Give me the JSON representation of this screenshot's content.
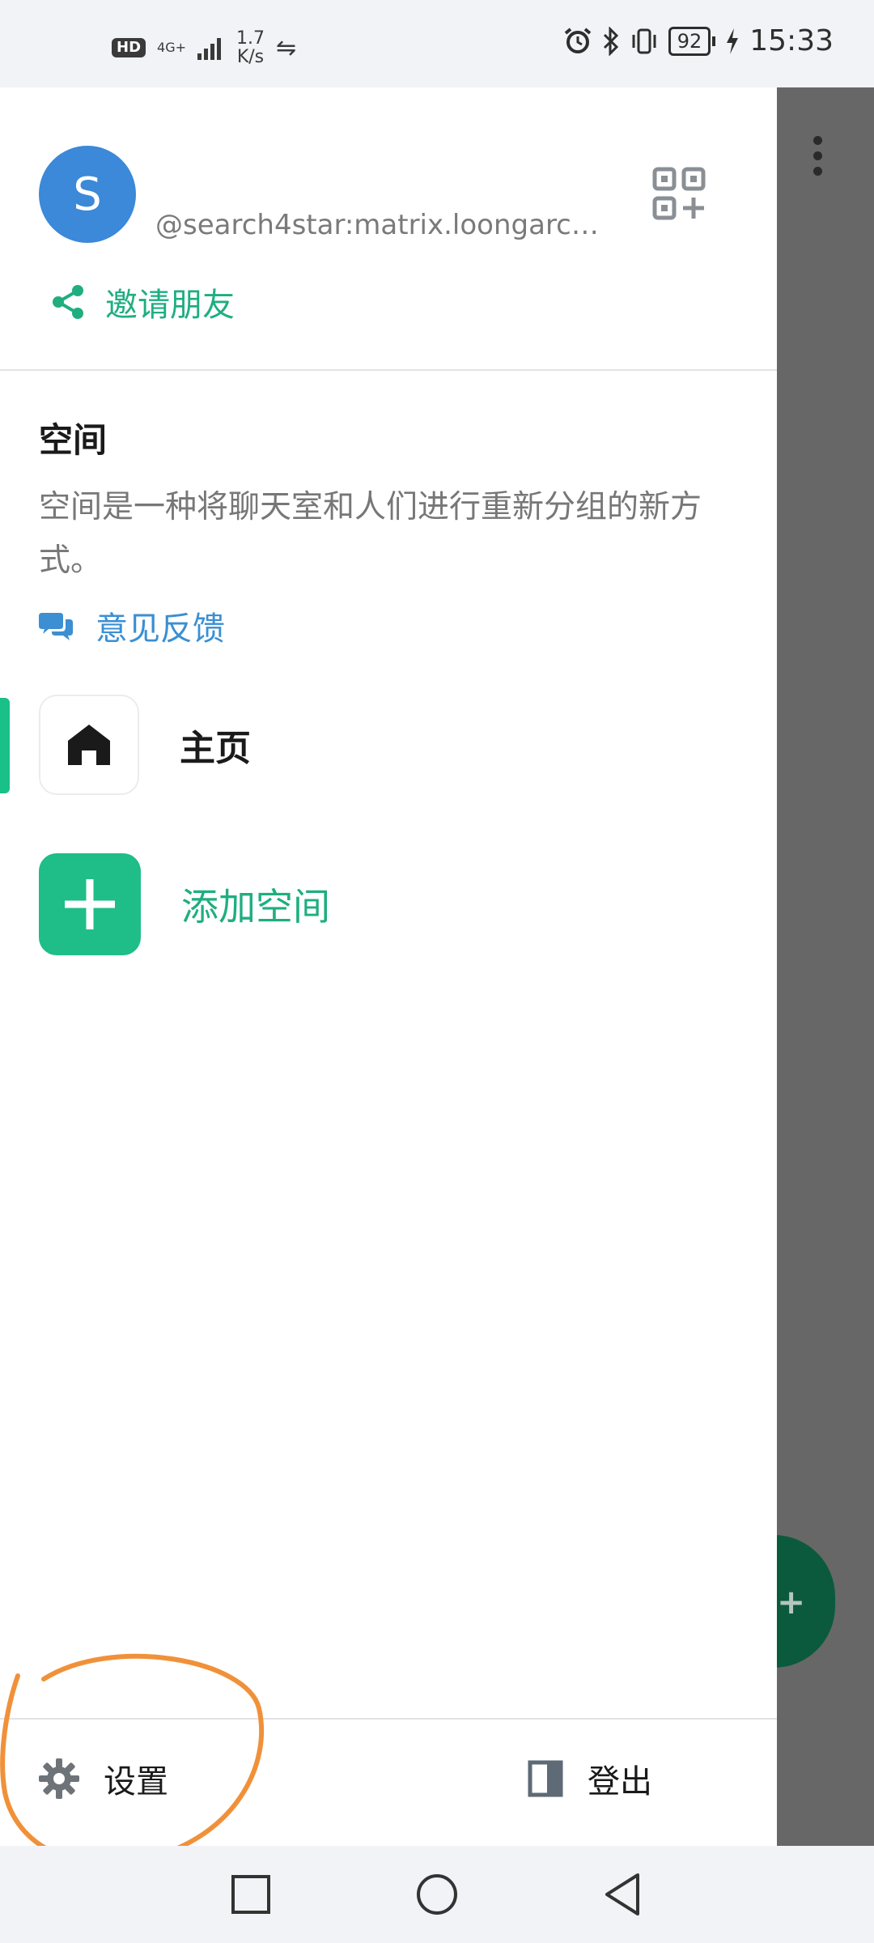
{
  "status_bar": {
    "hd": "HD",
    "network": "4G+",
    "speed_value": "1.7",
    "speed_unit": "K/s",
    "battery": "92",
    "time": "15:33"
  },
  "drawer": {
    "avatar_letter": "S",
    "username": "@search4star:matrix.loongarch...",
    "invite_label": "邀请朋友",
    "spaces_title": "空间",
    "spaces_description": "空间是一种将聊天室和人们进行重新分组的新方式。",
    "feedback_label": "意见反馈",
    "home_label": "主页",
    "add_space_label": "添加空间",
    "settings_label": "设置",
    "logout_label": "登出"
  },
  "colors": {
    "accent_green": "#1fae80",
    "avatar_blue": "#3b89d8",
    "feedback_blue": "#3b8fd2",
    "annotation_orange": "#f0913a"
  }
}
